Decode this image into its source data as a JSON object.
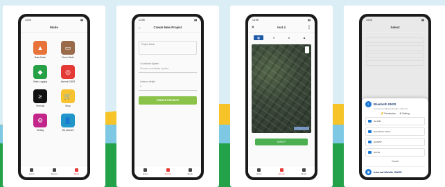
{
  "screens": {
    "home": {
      "app_title": "Mode",
      "tiles": [
        {
          "label": "Base Mode",
          "color": "#e8733a",
          "icon": "base-icon"
        },
        {
          "label": "Rover Mode",
          "color": "#9a6b4a",
          "icon": "rover-icon"
        },
        {
          "label": "Static Logging",
          "color": "#27a046",
          "icon": "logging-icon"
        },
        {
          "label": "Internal GNSS",
          "color": "#e53935",
          "icon": "gnss-icon"
        },
        {
          "label": "Terminal",
          "color": "#111111",
          "icon": "terminal-icon"
        },
        {
          "label": "Shop",
          "color": "#f7c331",
          "icon": "cart-icon"
        },
        {
          "label": "Setting",
          "color": "#c2268a",
          "icon": "gear-icon"
        },
        {
          "label": "My Account",
          "color": "#2196c9",
          "icon": "account-icon"
        }
      ]
    },
    "create_project": {
      "app_title": "Create New Project",
      "project_name_label": "Project Name",
      "coord_label": "Coordinate System",
      "coord_value": "Choose coordinate system",
      "antenna_label": "Antenna Height",
      "antenna_value": "0",
      "button_label": "CREATE PROJECT"
    },
    "map": {
      "app_title": "test 4",
      "button_label": "SURVEY"
    },
    "select": {
      "app_title": "Select",
      "sheet_title": "Bluetooth GNSS",
      "sheet_subtitle": "Connect your Bluetooth with a radio first",
      "permission_label": "Permission",
      "setting_label": "Setting",
      "devices": [
        "SA-F9N",
        "SoundCore Select",
        "HC06/07",
        "GM-06"
      ],
      "cancel_label": "Cancel",
      "internal_title": "Internal Mobile GNSS"
    }
  },
  "nav": {
    "home_tab": [
      "Home",
      "Survey",
      "Mode"
    ],
    "create_tab": [
      "Home",
      "Survey",
      "Mode"
    ],
    "map_tab": [
      "Home",
      "Survey",
      "Mode"
    ]
  },
  "status": {
    "time": "14:05"
  }
}
